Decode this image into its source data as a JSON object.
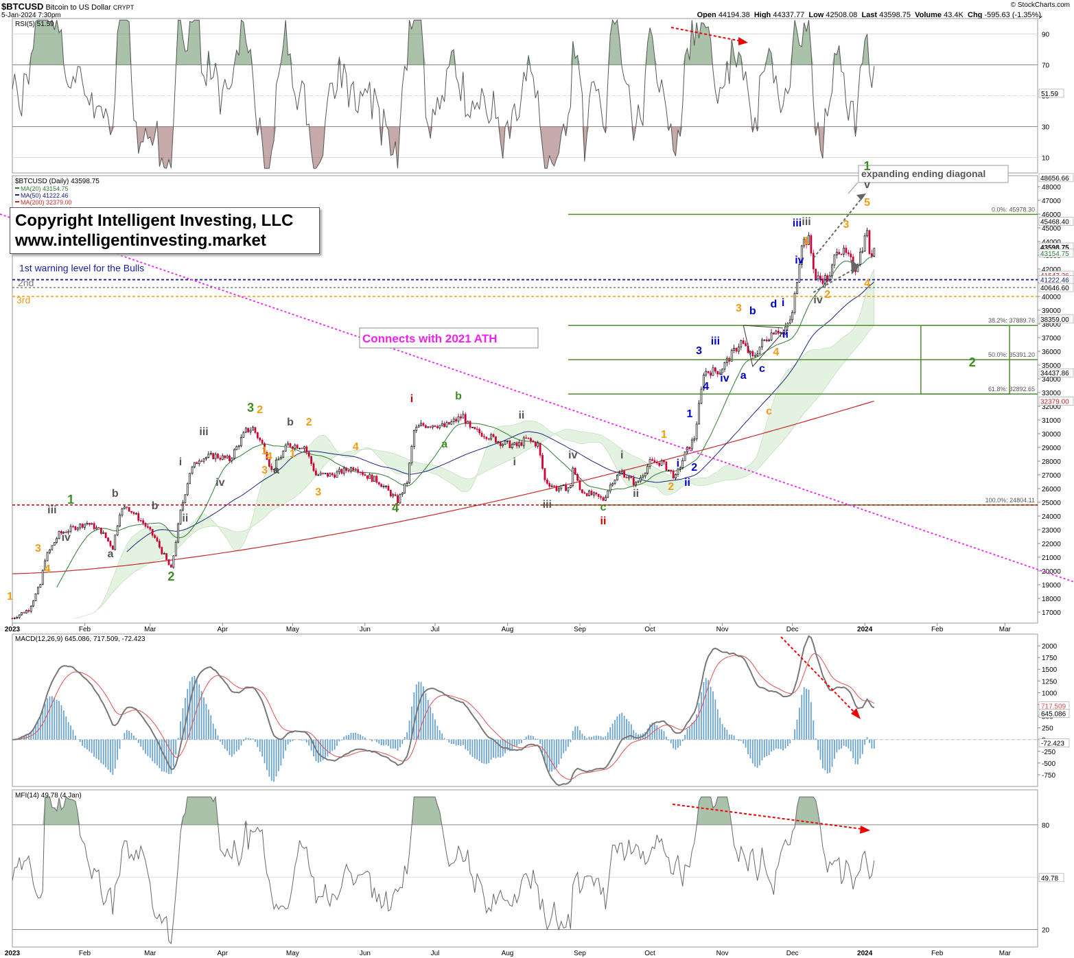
{
  "header": {
    "symbol": "$BTCUSD",
    "name": "Bitcoin to US Dollar",
    "exchange": "CRYPT",
    "date": "5-Jan-2024 7:30pm",
    "brand": "© StockCharts.com",
    "open_label": "Open",
    "open": "44194.38",
    "high_label": "High",
    "high": "44337.77",
    "low_label": "Low",
    "low": "42508.08",
    "last_label": "Last",
    "last": "43598.75",
    "volume_label": "Volume",
    "volume": "43.4K",
    "chg_label": "Chg",
    "chg": "-595.63 (-1.35%)"
  },
  "copyright": {
    "line1": "Copyright Intelligent Investing, LLC",
    "line2": "www.intelligentinvesting.market"
  },
  "annotations": {
    "warning1": "1st warning level for the Bulls",
    "warning2": "2nd",
    "warning3": "3rd",
    "ath": "Connects with 2021 ATH",
    "diagonal": "expanding ending diagonal"
  },
  "colors": {
    "up": "#000000",
    "down": "#cc0033",
    "ma20": "#2e7d32",
    "ma50": "#1a237e",
    "ma200": "#c62828",
    "green": "#4c8c2b",
    "orange": "#f39c12",
    "blue": "#0000cc",
    "red": "#cc0000",
    "grey": "#555555",
    "magenta": "#ee22ee"
  },
  "chart_data": [
    {
      "type": "line",
      "panel": "RSI(5)",
      "title": "RSI(5) 51.59",
      "last": "51.59",
      "ylim": [
        0,
        100
      ],
      "yticks": [
        "10",
        "30",
        "50",
        "70",
        "90"
      ],
      "levels": [
        70,
        30
      ],
      "divergence_arrow": true
    },
    {
      "type": "candlestick",
      "panel": "price",
      "title": "$BTCUSD (Daily) 43598.75",
      "x_start": "2023-01-01",
      "x_end": "2024-03-15",
      "xticks": [
        "2023",
        "Feb",
        "Mar",
        "Apr",
        "May",
        "Jun",
        "Jul",
        "Aug",
        "Sep",
        "Oct",
        "Nov",
        "Dec",
        "2024",
        "Feb",
        "Mar"
      ],
      "xtick_dates": [
        "2023-01-01",
        "2023-02-01",
        "2023-03-01",
        "2023-04-01",
        "2023-05-01",
        "2023-06-01",
        "2023-07-01",
        "2023-08-01",
        "2023-09-01",
        "2023-10-01",
        "2023-11-01",
        "2023-12-01",
        "2024-01-01",
        "2024-02-01",
        "2024-03-01"
      ],
      "ylim": [
        16200,
        48800
      ],
      "yticks": [
        "17000",
        "18000",
        "19000",
        "20000",
        "21000",
        "22000",
        "23000",
        "24000",
        "25000",
        "26000",
        "27000",
        "28000",
        "29000",
        "30000",
        "31000",
        "32000",
        "33000",
        "34000",
        "35000",
        "36000",
        "37000",
        "38000",
        "39000",
        "40000",
        "41000",
        "42000",
        "43000",
        "44000",
        "45000",
        "46000",
        "47000",
        "48000"
      ],
      "legend": [
        {
          "name": "MA(20) 43154.75",
          "color": "#2e7d32"
        },
        {
          "name": "MA(50) 41222.46",
          "color": "#1a237e"
        },
        {
          "name": "MA(200) 32379.00",
          "color": "#c62828"
        }
      ],
      "ohlc_anchors": [
        [
          "2023-01-01",
          16550
        ],
        [
          "2023-01-08",
          17200
        ],
        [
          "2023-01-13",
          19000
        ],
        [
          "2023-01-15",
          20900
        ],
        [
          "2023-01-21",
          22700
        ],
        [
          "2023-01-28",
          23200
        ],
        [
          "2023-02-02",
          23500
        ],
        [
          "2023-02-08",
          22900
        ],
        [
          "2023-02-13",
          21700
        ],
        [
          "2023-02-16",
          24300
        ],
        [
          "2023-02-19",
          24700
        ],
        [
          "2023-02-26",
          23500
        ],
        [
          "2023-03-03",
          22400
        ],
        [
          "2023-03-10",
          20100
        ],
        [
          "2023-03-14",
          24300
        ],
        [
          "2023-03-18",
          27200
        ],
        [
          "2023-03-22",
          28200
        ],
        [
          "2023-03-29",
          28400
        ],
        [
          "2023-04-04",
          28100
        ],
        [
          "2023-04-11",
          30200
        ],
        [
          "2023-04-14",
          30400
        ],
        [
          "2023-04-19",
          28900
        ],
        [
          "2023-04-22",
          27300
        ],
        [
          "2023-04-29",
          29200
        ],
        [
          "2023-05-06",
          29100
        ],
        [
          "2023-05-11",
          27000
        ],
        [
          "2023-05-18",
          27000
        ],
        [
          "2023-05-28",
          27600
        ],
        [
          "2023-06-01",
          27000
        ],
        [
          "2023-06-07",
          26500
        ],
        [
          "2023-06-15",
          25100
        ],
        [
          "2023-06-19",
          26500
        ],
        [
          "2023-06-22",
          30200
        ],
        [
          "2023-06-25",
          30600
        ],
        [
          "2023-07-01",
          30700
        ],
        [
          "2023-07-05",
          30500
        ],
        [
          "2023-07-13",
          31300
        ],
        [
          "2023-07-16",
          30300
        ],
        [
          "2023-07-23",
          29900
        ],
        [
          "2023-07-30",
          29300
        ],
        [
          "2023-08-05",
          29100
        ],
        [
          "2023-08-09",
          29600
        ],
        [
          "2023-08-14",
          29200
        ],
        [
          "2023-08-17",
          26600
        ],
        [
          "2023-08-22",
          26000
        ],
        [
          "2023-08-28",
          26100
        ],
        [
          "2023-08-29",
          27600
        ],
        [
          "2023-09-01",
          25900
        ],
        [
          "2023-09-11",
          25200
        ],
        [
          "2023-09-15",
          26600
        ],
        [
          "2023-09-19",
          27200
        ],
        [
          "2023-09-25",
          26300
        ],
        [
          "2023-10-01",
          27900
        ],
        [
          "2023-10-06",
          27900
        ],
        [
          "2023-10-12",
          26800
        ],
        [
          "2023-10-16",
          28500
        ],
        [
          "2023-10-20",
          29700
        ],
        [
          "2023-10-23",
          33100
        ],
        [
          "2023-10-24",
          34500
        ],
        [
          "2023-10-31",
          34600
        ],
        [
          "2023-11-09",
          36700
        ],
        [
          "2023-11-14",
          35500
        ],
        [
          "2023-11-18",
          36600
        ],
        [
          "2023-11-24",
          37700
        ],
        [
          "2023-11-27",
          37200
        ],
        [
          "2023-12-01",
          38700
        ],
        [
          "2023-12-05",
          44000
        ],
        [
          "2023-12-08",
          44100
        ],
        [
          "2023-12-11",
          41300
        ],
        [
          "2023-12-17",
          41300
        ],
        [
          "2023-12-20",
          43600
        ],
        [
          "2023-12-24",
          43000
        ],
        [
          "2023-12-28",
          42100
        ],
        [
          "2024-01-01",
          44200
        ],
        [
          "2024-01-02",
          45000
        ],
        [
          "2024-01-03",
          42800
        ],
        [
          "2024-01-05",
          43600
        ]
      ],
      "fib_levels": [
        {
          "label": "0.0%: 45978.30",
          "value": 45978.3
        },
        {
          "label": "38.2%: 37889.76",
          "value": 37889.76
        },
        {
          "label": "50.0%: 35391.20",
          "value": 35391.2
        },
        {
          "label": "61.8%: 32892.65",
          "value": 32892.65
        },
        {
          "label": "100.0%: 24804.11",
          "value": 24804.11
        }
      ],
      "warning_levels": [
        41222,
        40646,
        40000
      ],
      "right_labels": [
        {
          "text": "48656.66",
          "value": 48656.66,
          "color": "#000"
        },
        {
          "text": "45468.40",
          "value": 45468.4,
          "color": "#000"
        },
        {
          "text": "43598.75",
          "value": 43598.75,
          "color": "#000"
        },
        {
          "text": "43154.75",
          "value": 43154.75,
          "color": "#2e7d32"
        },
        {
          "text": "41547.26",
          "value": 41547.26,
          "color": "#c62828"
        },
        {
          "text": "41222.46",
          "value": 41222.46,
          "color": "#1a237e"
        },
        {
          "text": "40646.60",
          "value": 40646.6,
          "color": "#000"
        },
        {
          "text": "38359.00",
          "value": 38359,
          "color": "#000"
        },
        {
          "text": "34437.86",
          "value": 34437.86,
          "color": "#000"
        },
        {
          "text": "32379.00",
          "value": 32379,
          "color": "#c62828"
        }
      ],
      "wave_labels": [
        [
          "1",
          "2022-12-31",
          17900,
          "orange"
        ],
        [
          "3",
          "2023-01-12",
          21400,
          "orange"
        ],
        [
          "4",
          "2023-01-16",
          19900,
          "orange"
        ],
        [
          "iii",
          "2023-01-18",
          24200,
          "grey"
        ],
        [
          "iv",
          "2023-01-24",
          22200,
          "grey"
        ],
        [
          "1",
          "2023-01-26",
          24900,
          "green"
        ],
        [
          "b",
          "2023-02-14",
          25400,
          "grey"
        ],
        [
          "a",
          "2023-02-12",
          21000,
          "grey"
        ],
        [
          "b",
          "2023-03-03",
          24500,
          "grey"
        ],
        [
          "2",
          "2023-03-10",
          19300,
          "green"
        ],
        [
          "i",
          "2023-03-14",
          27700,
          "grey"
        ],
        [
          "ii",
          "2023-03-16",
          23600,
          "grey"
        ],
        [
          "iii",
          "2023-03-24",
          29900,
          "grey"
        ],
        [
          "iv",
          "2023-03-31",
          26200,
          "grey"
        ],
        [
          "3",
          "2023-04-13",
          31600,
          "green"
        ],
        [
          "2",
          "2023-04-17",
          31500,
          "orange"
        ],
        [
          "1",
          "2023-04-19",
          28500,
          "orange"
        ],
        [
          "4",
          "2023-04-21",
          28100,
          "orange"
        ],
        [
          "3",
          "2023-04-19",
          27100,
          "orange"
        ],
        [
          "a",
          "2023-04-24",
          27100,
          "grey"
        ],
        [
          "b",
          "2023-04-30",
          30600,
          "grey"
        ],
        [
          "2",
          "2023-05-08",
          30600,
          "orange"
        ],
        [
          "1",
          "2023-05-01",
          28300,
          "orange"
        ],
        [
          "3",
          "2023-05-12",
          25500,
          "orange"
        ],
        [
          "4",
          "2023-05-28",
          28800,
          "orange"
        ],
        [
          "4",
          "2023-06-14",
          24300,
          "green"
        ],
        [
          "i",
          "2023-06-21",
          32300,
          "red"
        ],
        [
          "b",
          "2023-07-11",
          32500,
          "green"
        ],
        [
          "a",
          "2023-07-05",
          29000,
          "green"
        ],
        [
          "ii",
          "2023-08-07",
          31100,
          "grey"
        ],
        [
          "i",
          "2023-08-04",
          27700,
          "grey"
        ],
        [
          "iv",
          "2023-08-29",
          28200,
          "grey"
        ],
        [
          "iii",
          "2023-08-18",
          24600,
          "grey"
        ],
        [
          "c",
          "2023-09-11",
          24400,
          "green"
        ],
        [
          "ii",
          "2023-09-11",
          23400,
          "red"
        ],
        [
          "i",
          "2023-09-19",
          28200,
          "grey"
        ],
        [
          "ii",
          "2023-09-25",
          25400,
          "grey"
        ],
        [
          "1",
          "2023-10-07",
          29700,
          "orange"
        ],
        [
          "i",
          "2023-10-13",
          27600,
          "blue"
        ],
        [
          "2",
          "2023-10-10",
          25900,
          "orange"
        ],
        [
          "ii",
          "2023-10-17",
          26200,
          "blue"
        ],
        [
          "2",
          "2023-10-20",
          27300,
          "blue"
        ],
        [
          "1",
          "2023-10-18",
          31200,
          "blue"
        ],
        [
          "3",
          "2023-10-22",
          35800,
          "blue"
        ],
        [
          "4",
          "2023-10-25",
          33200,
          "blue"
        ],
        [
          "iii",
          "2023-10-29",
          36500,
          "blue"
        ],
        [
          "iv",
          "2023-11-02",
          33800,
          "blue"
        ],
        [
          "3",
          "2023-11-08",
          38900,
          "orange"
        ],
        [
          "a",
          "2023-11-10",
          34000,
          "blue"
        ],
        [
          "b",
          "2023-11-14",
          38700,
          "blue"
        ],
        [
          "c",
          "2023-11-18",
          34500,
          "blue"
        ],
        [
          "4",
          "2023-11-24",
          35700,
          "orange"
        ],
        [
          "d",
          "2023-11-23",
          39200,
          "blue"
        ],
        [
          "i",
          "2023-11-27",
          39300,
          "blue"
        ],
        [
          "ii",
          "2023-11-28",
          37000,
          "blue"
        ],
        [
          "c",
          "2023-11-21",
          31400,
          "orange"
        ],
        [
          "iii",
          "2023-12-03",
          45100,
          "blue"
        ],
        [
          "iii",
          "2023-12-07",
          45200,
          "grey"
        ],
        [
          "iv",
          "2023-12-04",
          42400,
          "blue"
        ],
        [
          "1",
          "2023-12-07",
          43800,
          "orange"
        ],
        [
          "iv",
          "2023-12-12",
          39500,
          "grey"
        ],
        [
          "2",
          "2023-12-16",
          39900,
          "orange"
        ],
        [
          "3",
          "2023-12-24",
          45000,
          "orange"
        ],
        [
          "4",
          "2024-01-02",
          40700,
          "orange"
        ],
        [
          "5",
          "2024-01-02",
          46600,
          "orange"
        ],
        [
          "v",
          "2024-01-02",
          47900,
          "grey"
        ],
        [
          "1",
          "2024-01-02",
          49200,
          "green"
        ],
        [
          "2",
          "2024-02-16",
          34900,
          "green"
        ]
      ]
    },
    {
      "type": "line",
      "panel": "MACD",
      "title": "MACD(12,26,9) 645.086, 717.509, -72.423",
      "series": [
        {
          "name": "645.086"
        },
        {
          "name": "717.509"
        },
        {
          "name": "-72.423"
        }
      ],
      "ylim": [
        -1000,
        2250
      ],
      "yticks": [
        "-750",
        "-500",
        "-250",
        "0",
        "250",
        "500",
        "750",
        "1000",
        "1250",
        "1500",
        "1750",
        "2000"
      ],
      "right_labels": [
        "717.509",
        "645.086",
        "-72.423"
      ]
    },
    {
      "type": "line",
      "panel": "MFI(14)",
      "title": "MFI(14) 49.78 (4 Jan)",
      "last": "49.78",
      "ylim": [
        10,
        100
      ],
      "yticks": [
        "20",
        "50",
        "80"
      ],
      "levels": [
        80,
        20
      ],
      "divergence_arrow": true
    }
  ]
}
